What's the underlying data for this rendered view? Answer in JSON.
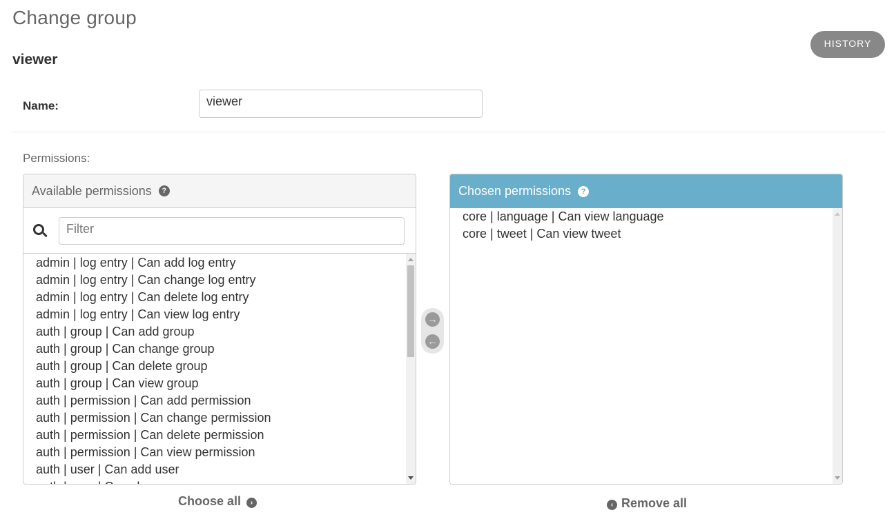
{
  "page": {
    "title": "Change group",
    "object_name": "viewer",
    "history_label": "HISTORY"
  },
  "form": {
    "name_label": "Name:",
    "name_value": "viewer",
    "permissions_label": "Permissions:"
  },
  "available": {
    "title": "Available permissions",
    "help_icon": "?",
    "filter_placeholder": "Filter",
    "items": [
      "admin | log entry | Can add log entry",
      "admin | log entry | Can change log entry",
      "admin | log entry | Can delete log entry",
      "admin | log entry | Can view log entry",
      "auth | group | Can add group",
      "auth | group | Can change group",
      "auth | group | Can delete group",
      "auth | group | Can view group",
      "auth | permission | Can add permission",
      "auth | permission | Can change permission",
      "auth | permission | Can delete permission",
      "auth | permission | Can view permission",
      "auth | user | Can add user",
      "auth | user | Can change user"
    ],
    "choose_all_label": "Choose all"
  },
  "chosen": {
    "title": "Chosen permissions",
    "help_icon": "?",
    "items": [
      "core | language | Can view language",
      "core | tweet | Can view tweet"
    ],
    "remove_all_label": "Remove all"
  },
  "icons": {
    "add_arrow": "→",
    "remove_arrow": "←",
    "choose_all_chevron": "›",
    "remove_all_chevron": "‹"
  },
  "colors": {
    "chosen_header": "#69aecb",
    "history_button": "#888888"
  }
}
